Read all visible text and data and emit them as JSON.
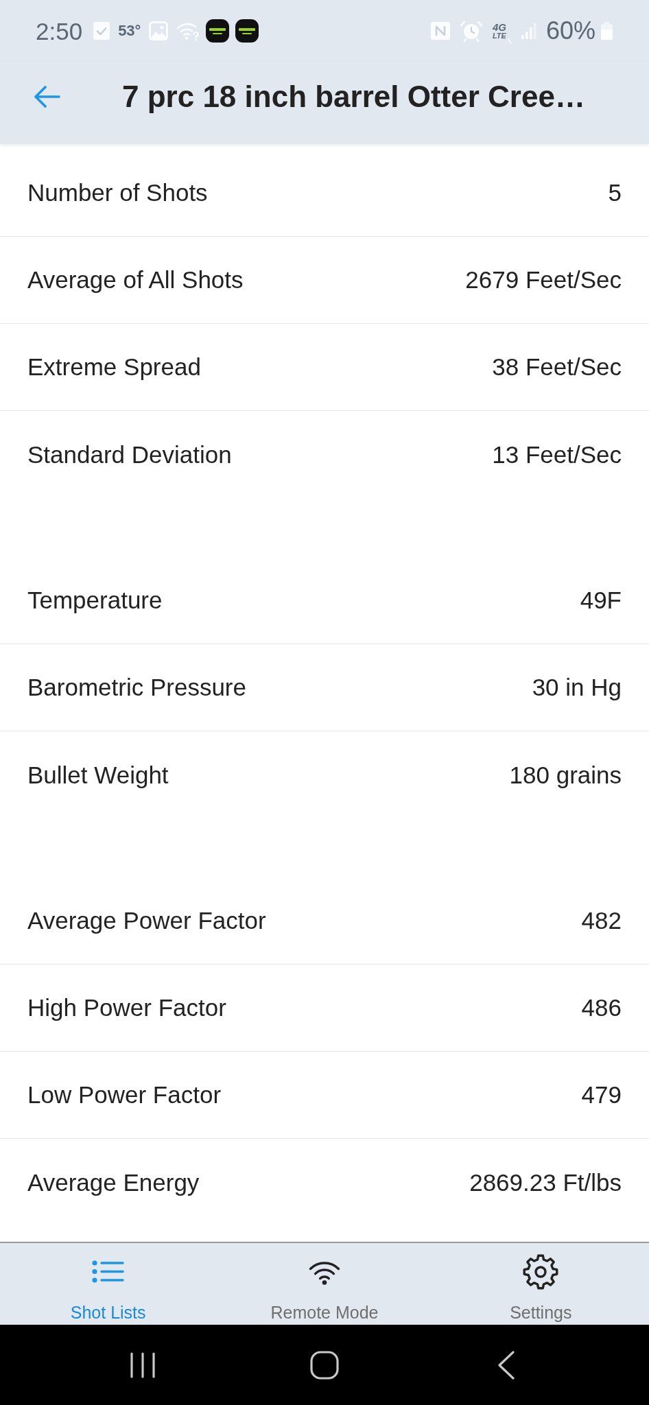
{
  "status_bar": {
    "time": "2:50",
    "temperature": "53°",
    "network": {
      "generation": "4G",
      "type": "LTE"
    },
    "battery": "60%"
  },
  "header": {
    "title": "7 prc 18 inch barrel Otter Cree…"
  },
  "stat_groups": [
    {
      "rows": [
        {
          "label": "Number of Shots",
          "value": "5"
        },
        {
          "label": "Average of All Shots",
          "value": "2679 Feet/Sec"
        },
        {
          "label": "Extreme Spread",
          "value": "38 Feet/Sec"
        },
        {
          "label": "Standard Deviation",
          "value": "13 Feet/Sec"
        }
      ]
    },
    {
      "rows": [
        {
          "label": "Temperature",
          "value": "49F"
        },
        {
          "label": "Barometric Pressure",
          "value": "30 in Hg"
        },
        {
          "label": "Bullet Weight",
          "value": "180 grains"
        }
      ]
    },
    {
      "rows": [
        {
          "label": "Average Power Factor",
          "value": "482"
        },
        {
          "label": "High Power Factor",
          "value": "486"
        },
        {
          "label": "Low Power Factor",
          "value": "479"
        },
        {
          "label": "Average Energy",
          "value": "2869.23 Ft/lbs"
        }
      ]
    }
  ],
  "bottom_nav": [
    {
      "label": "Shot Lists",
      "selected": true
    },
    {
      "label": "Remote Mode",
      "selected": false
    },
    {
      "label": "Settings",
      "selected": false
    }
  ]
}
